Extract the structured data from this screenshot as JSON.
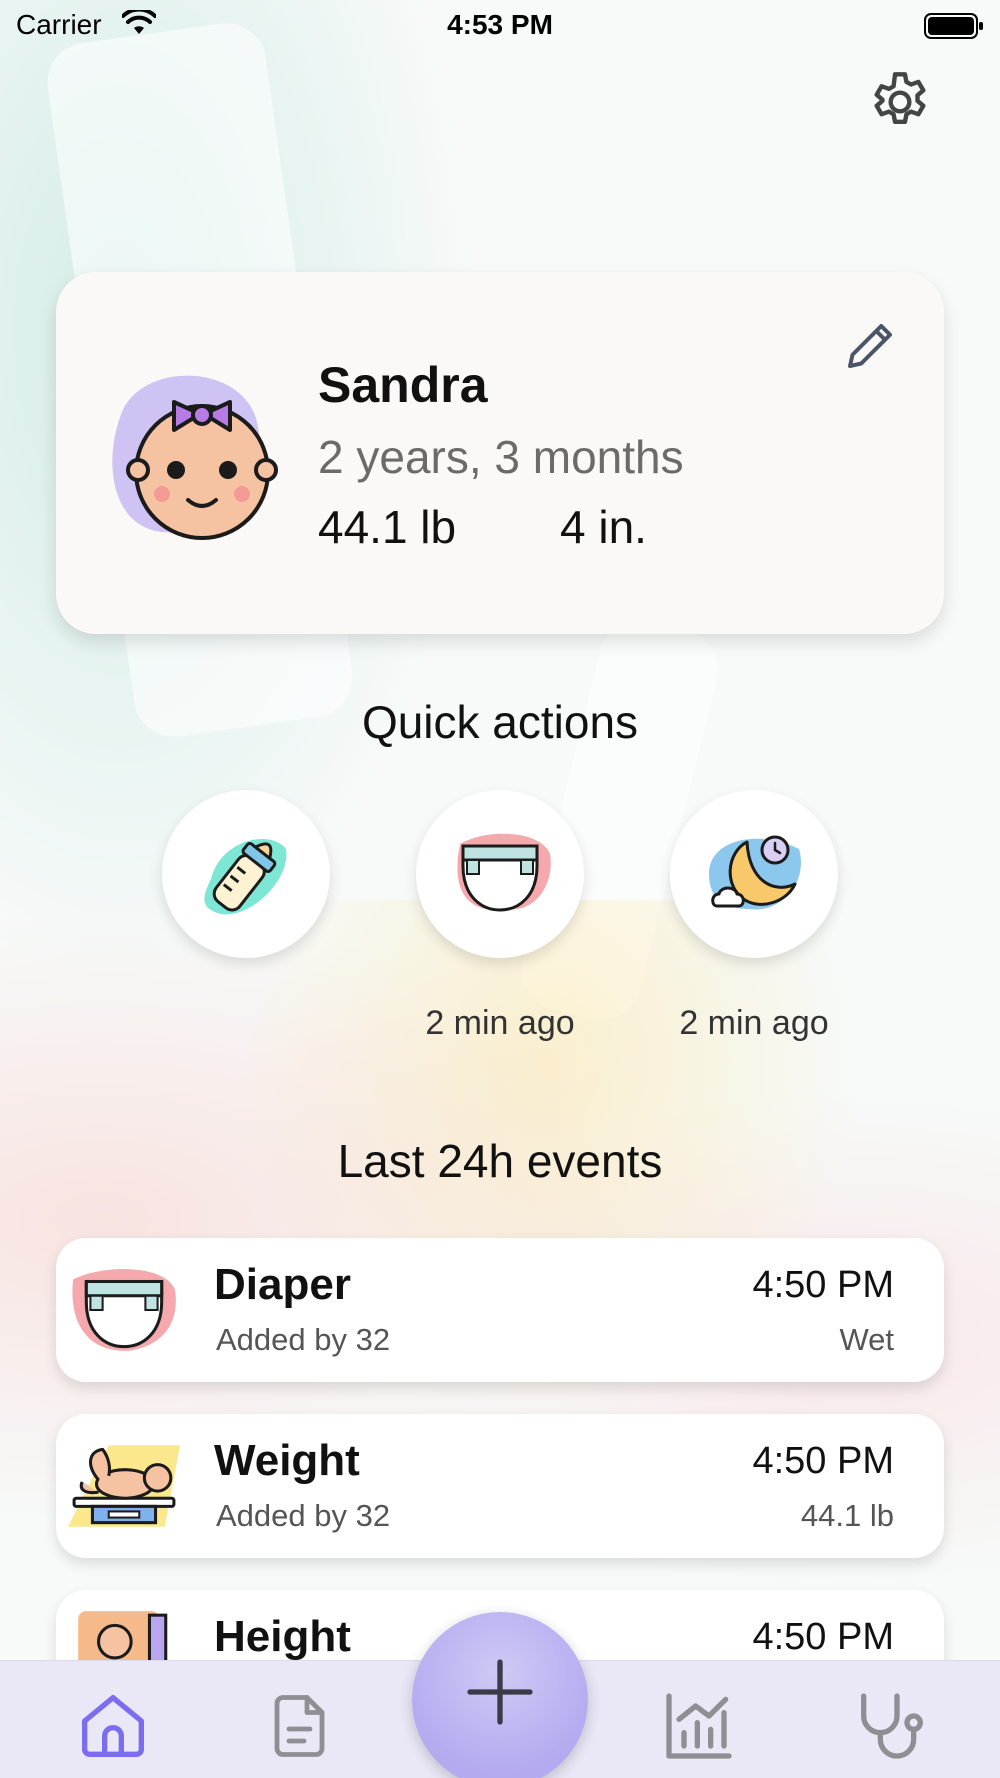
{
  "status_bar": {
    "carrier": "Carrier",
    "time": "4:53 PM"
  },
  "profile": {
    "name": "Sandra",
    "age": "2 years, 3 months",
    "weight": "44.1 lb",
    "height": "4 in."
  },
  "quick_actions": {
    "title": "Quick actions",
    "items": [
      {
        "icon": "bottle-icon",
        "caption": ""
      },
      {
        "icon": "diaper-icon",
        "caption": "2 min ago"
      },
      {
        "icon": "sleep-icon",
        "caption": "2 min ago"
      }
    ]
  },
  "events": {
    "title": "Last 24h events",
    "items": [
      {
        "icon": "diaper-icon",
        "name": "Diaper",
        "added_by": "Added by 32",
        "time": "4:50 PM",
        "detail": "Wet"
      },
      {
        "icon": "weight-scale-icon",
        "name": "Weight",
        "added_by": "Added by 32",
        "time": "4:50 PM",
        "detail": "44.1 lb"
      },
      {
        "icon": "height-ruler-icon",
        "name": "Height",
        "added_by": "",
        "time": "4:50 PM",
        "detail": ""
      }
    ]
  },
  "tab_bar": {
    "tabs": [
      "home-icon",
      "document-icon",
      "add-icon",
      "chart-icon",
      "stethoscope-icon"
    ],
    "active": "home-icon",
    "active_color": "#7c6cf0",
    "inactive_color": "#8e8e93"
  }
}
